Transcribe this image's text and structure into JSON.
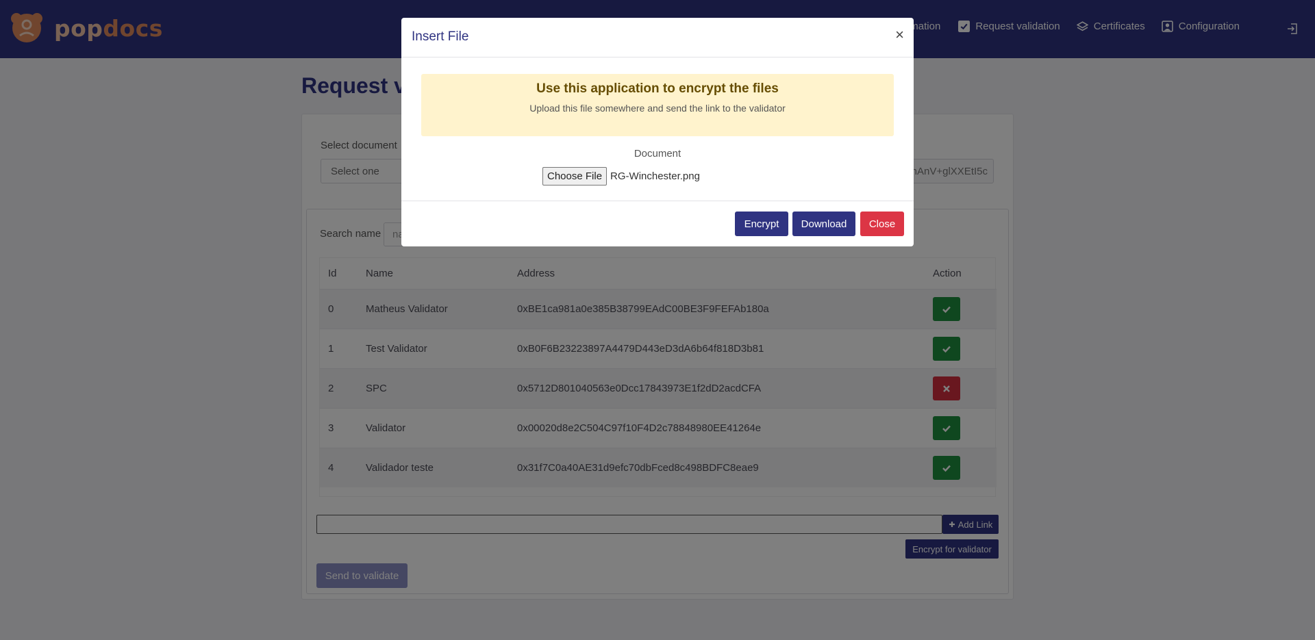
{
  "brand": {
    "pop": "pop",
    "docs": "docs"
  },
  "nav": {
    "items": [
      {
        "label": "nformation",
        "icon": "info-icon"
      },
      {
        "label": "Request validation",
        "icon": "checkbox-icon"
      },
      {
        "label": "Certificates",
        "icon": "layers-icon"
      },
      {
        "label": "Configuration",
        "icon": "user-square-icon"
      }
    ],
    "logout_icon": "logout-icon"
  },
  "page": {
    "title": "Request va",
    "select_label": "Select document",
    "select_value": "Select one",
    "key_value": "nAnV+glXXEtI5c",
    "search_label": "Search name",
    "search_placeholder": "na",
    "table": {
      "headers": {
        "id": "Id",
        "name": "Name",
        "address": "Address",
        "action": "Action"
      },
      "rows": [
        {
          "id": "0",
          "name": "Matheus Validator",
          "address": "0xBE1ca981a0e385B38799EAdC00BE3F9FEFAb180a",
          "status": "ok"
        },
        {
          "id": "1",
          "name": "Test Validator",
          "address": "0xB0F6B23223897A4479D443eD3dA6b64f818D3b81",
          "status": "ok"
        },
        {
          "id": "2",
          "name": "SPC",
          "address": "0x5712D801040563e0Dcc17843973E1f2dD2acdCFA",
          "status": "remove"
        },
        {
          "id": "3",
          "name": "Validator",
          "address": "0x00020d8e2C504C97f10F4D2c78848980EE41264e",
          "status": "ok"
        },
        {
          "id": "4",
          "name": "Validador teste",
          "address": "0x31f7C0a40AE31d9efc70dbFced8c498BDFC8eae9",
          "status": "ok"
        }
      ]
    },
    "add_link": "Add Link",
    "encrypt_for_validator": "Encrypt for validator",
    "send_to_validate": "Send to validate"
  },
  "modal": {
    "title": "Insert File",
    "close_symbol": "×",
    "alert_title": "Use this application to encrypt the files",
    "alert_subtitle": "Upload this file somewhere and send the link to the validator",
    "document_label": "Document",
    "choose_file": "Choose File",
    "file_name": "RG-Winchester.png",
    "buttons": {
      "encrypt": "Encrypt",
      "download": "Download",
      "close": "Close"
    }
  },
  "colors": {
    "brand_navy": "#2f3381",
    "success": "#1e8e3e",
    "danger": "#d32f3f",
    "alert_bg": "#fff3cd",
    "logo_orange": "#e08a5c"
  }
}
